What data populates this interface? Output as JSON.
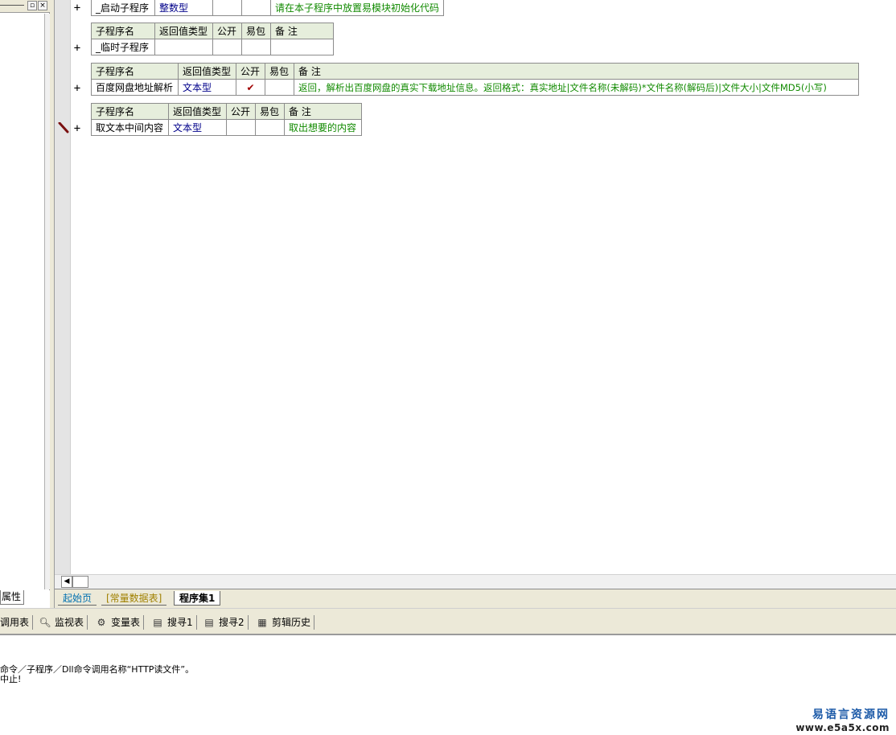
{
  "left_panel": {
    "tab_label": "属性",
    "restore_glyph": "▫",
    "close_glyph": "×"
  },
  "editor": {
    "header_labels": {
      "name": "子程序名",
      "return_type": "返回值类型",
      "public": "公开",
      "easy_pack": "易包",
      "note": "备 注"
    },
    "subroutines": [
      {
        "name": "_启动子程序",
        "return_type": "整数型",
        "public": "",
        "easy_pack": "",
        "note": "请在本子程序中放置易模块初始化代码"
      },
      {
        "name": "_临时子程序",
        "return_type": "",
        "public": "",
        "easy_pack": "",
        "note": ""
      },
      {
        "name": "百度网盘地址解析",
        "return_type": "文本型",
        "public": "✔",
        "easy_pack": "",
        "note": "返回，解析出百度网盘的真实下载地址信息。返回格式：真实地址|文件名称(未解码)*文件名称(解码后)|文件大小|文件MD5(小写)"
      },
      {
        "name": "取文本中间内容",
        "return_type": "文本型",
        "public": "",
        "easy_pack": "",
        "note": "取出想要的内容"
      }
    ],
    "plus_glyph": "+"
  },
  "doc_tabs": [
    "起始页",
    "[常量数据表]",
    "程序集1"
  ],
  "toolbar": {
    "items": [
      {
        "label": "调用表",
        "icon": "call-table-icon"
      },
      {
        "label": "监视表",
        "icon": "magnifier-icon"
      },
      {
        "label": "变量表",
        "icon": "variables-icon"
      },
      {
        "label": "搜寻1",
        "icon": "search-doc-icon"
      },
      {
        "label": "搜寻2",
        "icon": "search-doc-icon"
      },
      {
        "label": "剪辑历史",
        "icon": "clipboard-icon"
      }
    ]
  },
  "output": {
    "lines": [
      "命令／子程序／Dll命令调用名称“HTTP读文件”。",
      "中止!"
    ]
  },
  "watermark": {
    "cn": "易语言资源网",
    "url": "www.e5a5x.com"
  },
  "colors": {
    "header_bg": "#e6eedc",
    "type_text": "#00008a",
    "note_text": "#118a00",
    "check_mark": "#a00000",
    "watermark_blue": "#1c5aa8"
  }
}
